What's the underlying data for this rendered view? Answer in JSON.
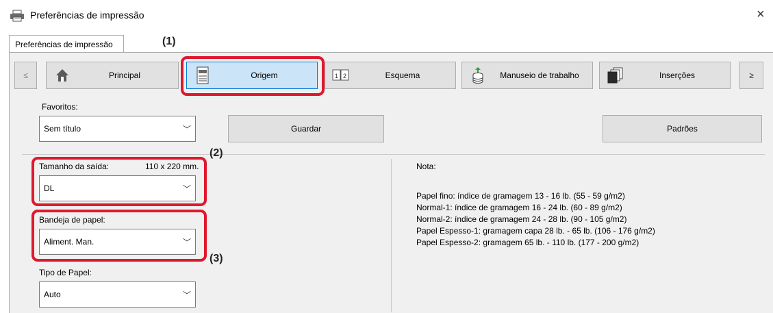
{
  "window": {
    "title": "Preferências de impressão",
    "close_label": "×"
  },
  "tab": {
    "label": "Preferências de impressão"
  },
  "nav": {
    "prev_label": "≤",
    "next_label": "≥",
    "buttons": [
      {
        "label": "Principal",
        "icon": "home-icon"
      },
      {
        "label": "Origem",
        "icon": "paper-tray-icon"
      },
      {
        "label": "Esquema",
        "icon": "layout-pages-icon"
      },
      {
        "label": "Manuseio de trabalho",
        "icon": "job-stack-icon"
      },
      {
        "label": "Inserções",
        "icon": "insert-pages-icon"
      }
    ]
  },
  "favorites": {
    "label": "Favoritos:",
    "value": "Sem título",
    "save_label": "Guardar",
    "defaults_label": "Padrões"
  },
  "output_size": {
    "label": "Tamanho da saída:",
    "dimension": "110 x 220 mm.",
    "value": "DL"
  },
  "paper_tray": {
    "label": "Bandeja de papel:",
    "value": "Aliment. Man."
  },
  "paper_type": {
    "label": "Tipo de Papel:",
    "value": "Auto"
  },
  "note": {
    "heading": "Nota:",
    "lines": [
      "Papel fino: índice de gramagem 13 - 16 lb. (55 - 59 g/m2)",
      "Normal-1: índice de gramagem 16 - 24 lb. (60 - 89 g/m2)",
      "Normal-2: índice de gramagem 24 - 28 lb. (90 - 105 g/m2)",
      "Papel Espesso-1: gramagem capa 28 lb. - 65 lb. (106 - 176 g/m2)",
      "Papel Espesso-2: gramagem 65 lb. - 110 lb. (177 - 200 g/m2)"
    ]
  },
  "callouts": {
    "c1": "(1)",
    "c2": "(2)",
    "c3": "(3)"
  },
  "colors": {
    "highlight": "#e0182d",
    "active_tab": "#cce4f7",
    "panel_bg": "#f0f0f0"
  }
}
